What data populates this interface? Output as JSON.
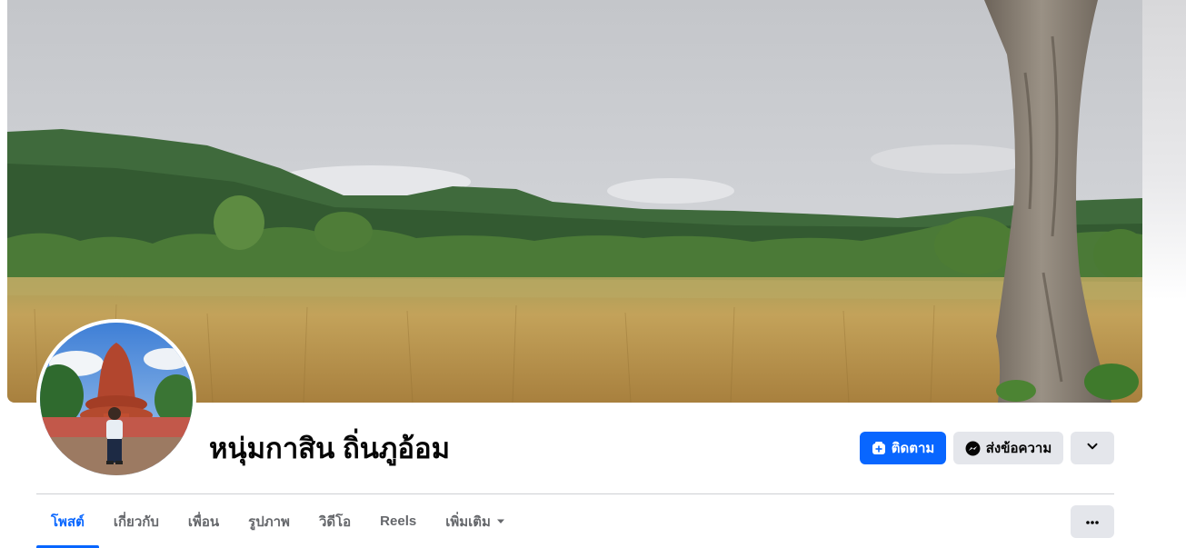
{
  "profile": {
    "name": "หนุ่มกาสิน ถิ่นภูอ้อม",
    "cover_icon": "landscape-photo",
    "avatar_icon": "person-photo"
  },
  "actions": {
    "follow_label": "ติดตาม",
    "follow_icon": "add-follow-icon",
    "message_label": "ส่งข้อความ",
    "message_icon": "messenger-icon",
    "more_icon": "chevron-down-icon"
  },
  "tabs": [
    {
      "label": "โพสต์",
      "active": true
    },
    {
      "label": "เกี่ยวกับ",
      "active": false
    },
    {
      "label": "เพื่อน",
      "active": false
    },
    {
      "label": "รูปภาพ",
      "active": false
    },
    {
      "label": "วิดีโอ",
      "active": false
    },
    {
      "label": "Reels",
      "active": false
    },
    {
      "label": "เพิ่มเติม",
      "active": false
    }
  ],
  "tab_more_icon": "ellipsis-icon",
  "colors": {
    "accent": "#0866ff",
    "secondary_button": "#e4e6eb",
    "muted_text": "#65676b",
    "divider": "#ced0d4"
  }
}
